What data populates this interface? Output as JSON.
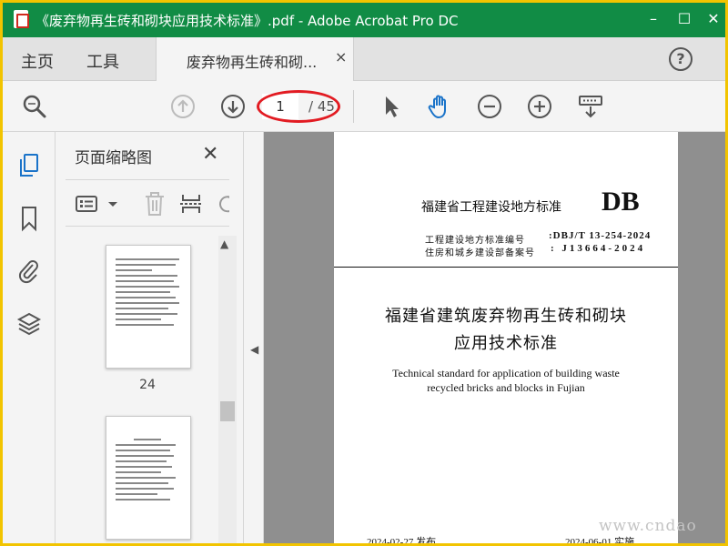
{
  "window": {
    "title": "《废弃物再生砖和砌块应用技术标准》.pdf - Adobe Acrobat Pro DC",
    "minimize": "–",
    "maximize": "☐",
    "close": "✕"
  },
  "nav": {
    "home": "主页",
    "tools": "工具",
    "tab_label": "废弃物再生砖和砌...",
    "tab_close": "×",
    "help": "?"
  },
  "toolbar": {
    "page_current": "1",
    "page_total": "/ 45",
    "icons": [
      "search-zoom-icon",
      "page-up-icon",
      "page-down-icon",
      "select-cursor-icon",
      "hand-tool-icon",
      "zoom-out-icon",
      "zoom-in-icon",
      "keyboard-scroll-icon"
    ],
    "accent_color": "#1a73c9",
    "highlight_color": "#e21b22"
  },
  "panel": {
    "title": "页面缩略图",
    "close": "✕",
    "thumb_labels": [
      "24"
    ]
  },
  "document": {
    "header_left": "福建省工程建设地方标准",
    "header_right": "DB",
    "std_number_label": "工程建设地方标准编号",
    "std_number_value": ":DBJ/T 13-254-2024",
    "record_label": "住房和城乡建设部备案号",
    "record_value": ":  J13664-2024",
    "title_cn_line1": "福建省建筑废弃物再生砖和砌块",
    "title_cn_line2": "应用技术标准",
    "title_en_line1": "Technical standard for application of building waste",
    "title_en_line2": "recycled bricks and blocks in Fujian",
    "issue_date": "2024-02-27    发布",
    "implement_date": "2024-06-01    实施"
  },
  "watermark": "www.cndao",
  "colors": {
    "titlebar": "#118c45",
    "frame": "#f2c400"
  }
}
